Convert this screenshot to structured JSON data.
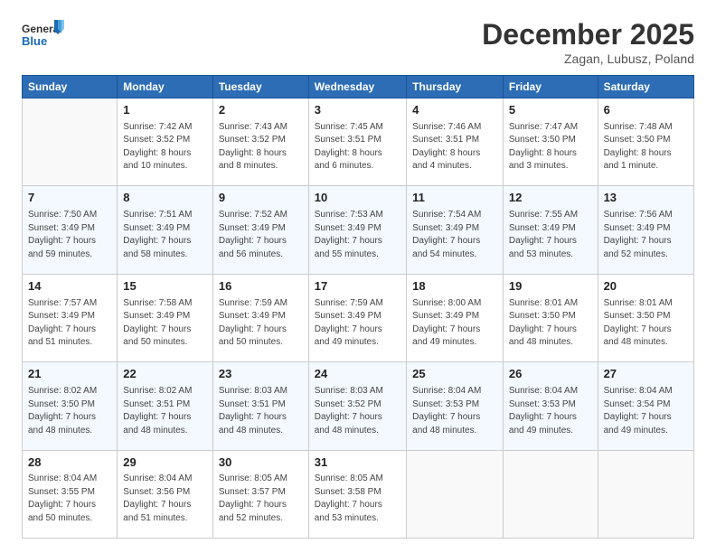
{
  "header": {
    "logo_line1": "General",
    "logo_line2": "Blue",
    "month": "December 2025",
    "location": "Zagan, Lubusz, Poland"
  },
  "days_of_week": [
    "Sunday",
    "Monday",
    "Tuesday",
    "Wednesday",
    "Thursday",
    "Friday",
    "Saturday"
  ],
  "weeks": [
    [
      {
        "day": "",
        "info": ""
      },
      {
        "day": "1",
        "info": "Sunrise: 7:42 AM\nSunset: 3:52 PM\nDaylight: 8 hours\nand 10 minutes."
      },
      {
        "day": "2",
        "info": "Sunrise: 7:43 AM\nSunset: 3:52 PM\nDaylight: 8 hours\nand 8 minutes."
      },
      {
        "day": "3",
        "info": "Sunrise: 7:45 AM\nSunset: 3:51 PM\nDaylight: 8 hours\nand 6 minutes."
      },
      {
        "day": "4",
        "info": "Sunrise: 7:46 AM\nSunset: 3:51 PM\nDaylight: 8 hours\nand 4 minutes."
      },
      {
        "day": "5",
        "info": "Sunrise: 7:47 AM\nSunset: 3:50 PM\nDaylight: 8 hours\nand 3 minutes."
      },
      {
        "day": "6",
        "info": "Sunrise: 7:48 AM\nSunset: 3:50 PM\nDaylight: 8 hours\nand 1 minute."
      }
    ],
    [
      {
        "day": "7",
        "info": "Sunrise: 7:50 AM\nSunset: 3:49 PM\nDaylight: 7 hours\nand 59 minutes."
      },
      {
        "day": "8",
        "info": "Sunrise: 7:51 AM\nSunset: 3:49 PM\nDaylight: 7 hours\nand 58 minutes."
      },
      {
        "day": "9",
        "info": "Sunrise: 7:52 AM\nSunset: 3:49 PM\nDaylight: 7 hours\nand 56 minutes."
      },
      {
        "day": "10",
        "info": "Sunrise: 7:53 AM\nSunset: 3:49 PM\nDaylight: 7 hours\nand 55 minutes."
      },
      {
        "day": "11",
        "info": "Sunrise: 7:54 AM\nSunset: 3:49 PM\nDaylight: 7 hours\nand 54 minutes."
      },
      {
        "day": "12",
        "info": "Sunrise: 7:55 AM\nSunset: 3:49 PM\nDaylight: 7 hours\nand 53 minutes."
      },
      {
        "day": "13",
        "info": "Sunrise: 7:56 AM\nSunset: 3:49 PM\nDaylight: 7 hours\nand 52 minutes."
      }
    ],
    [
      {
        "day": "14",
        "info": "Sunrise: 7:57 AM\nSunset: 3:49 PM\nDaylight: 7 hours\nand 51 minutes."
      },
      {
        "day": "15",
        "info": "Sunrise: 7:58 AM\nSunset: 3:49 PM\nDaylight: 7 hours\nand 50 minutes."
      },
      {
        "day": "16",
        "info": "Sunrise: 7:59 AM\nSunset: 3:49 PM\nDaylight: 7 hours\nand 50 minutes."
      },
      {
        "day": "17",
        "info": "Sunrise: 7:59 AM\nSunset: 3:49 PM\nDaylight: 7 hours\nand 49 minutes."
      },
      {
        "day": "18",
        "info": "Sunrise: 8:00 AM\nSunset: 3:49 PM\nDaylight: 7 hours\nand 49 minutes."
      },
      {
        "day": "19",
        "info": "Sunrise: 8:01 AM\nSunset: 3:50 PM\nDaylight: 7 hours\nand 48 minutes."
      },
      {
        "day": "20",
        "info": "Sunrise: 8:01 AM\nSunset: 3:50 PM\nDaylight: 7 hours\nand 48 minutes."
      }
    ],
    [
      {
        "day": "21",
        "info": "Sunrise: 8:02 AM\nSunset: 3:50 PM\nDaylight: 7 hours\nand 48 minutes."
      },
      {
        "day": "22",
        "info": "Sunrise: 8:02 AM\nSunset: 3:51 PM\nDaylight: 7 hours\nand 48 minutes."
      },
      {
        "day": "23",
        "info": "Sunrise: 8:03 AM\nSunset: 3:51 PM\nDaylight: 7 hours\nand 48 minutes."
      },
      {
        "day": "24",
        "info": "Sunrise: 8:03 AM\nSunset: 3:52 PM\nDaylight: 7 hours\nand 48 minutes."
      },
      {
        "day": "25",
        "info": "Sunrise: 8:04 AM\nSunset: 3:53 PM\nDaylight: 7 hours\nand 48 minutes."
      },
      {
        "day": "26",
        "info": "Sunrise: 8:04 AM\nSunset: 3:53 PM\nDaylight: 7 hours\nand 49 minutes."
      },
      {
        "day": "27",
        "info": "Sunrise: 8:04 AM\nSunset: 3:54 PM\nDaylight: 7 hours\nand 49 minutes."
      }
    ],
    [
      {
        "day": "28",
        "info": "Sunrise: 8:04 AM\nSunset: 3:55 PM\nDaylight: 7 hours\nand 50 minutes."
      },
      {
        "day": "29",
        "info": "Sunrise: 8:04 AM\nSunset: 3:56 PM\nDaylight: 7 hours\nand 51 minutes."
      },
      {
        "day": "30",
        "info": "Sunrise: 8:05 AM\nSunset: 3:57 PM\nDaylight: 7 hours\nand 52 minutes."
      },
      {
        "day": "31",
        "info": "Sunrise: 8:05 AM\nSunset: 3:58 PM\nDaylight: 7 hours\nand 53 minutes."
      },
      {
        "day": "",
        "info": ""
      },
      {
        "day": "",
        "info": ""
      },
      {
        "day": "",
        "info": ""
      }
    ]
  ]
}
